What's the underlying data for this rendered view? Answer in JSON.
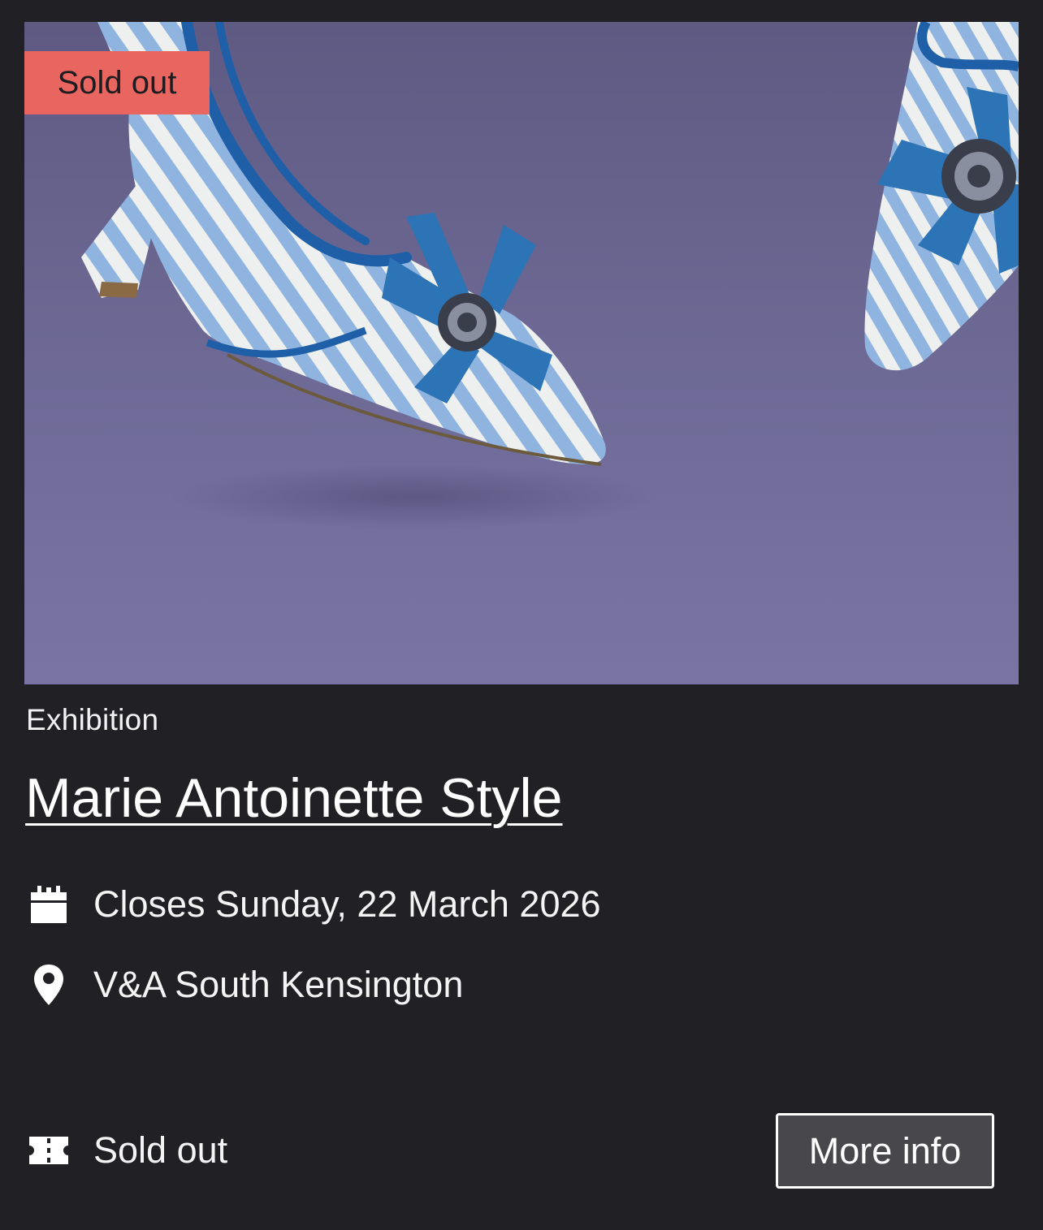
{
  "event": {
    "badge": "Sold out",
    "category": "Exhibition",
    "title": "Marie Antoinette Style",
    "date_text": "Closes Sunday, 22 March 2026",
    "location_text": "V&A South Kensington",
    "ticket_status": "Sold out",
    "more_info_label": "More info"
  },
  "image": {
    "description_icon": "striped-shoe-photo"
  },
  "icons": {
    "date": "calendar-icon",
    "location": "map-pin-icon",
    "tickets": "ticket-icon"
  },
  "colors": {
    "background": "#212024",
    "badge": "#e8665f",
    "button_bg": "#47474c",
    "photo_bg": "#6c6893"
  }
}
